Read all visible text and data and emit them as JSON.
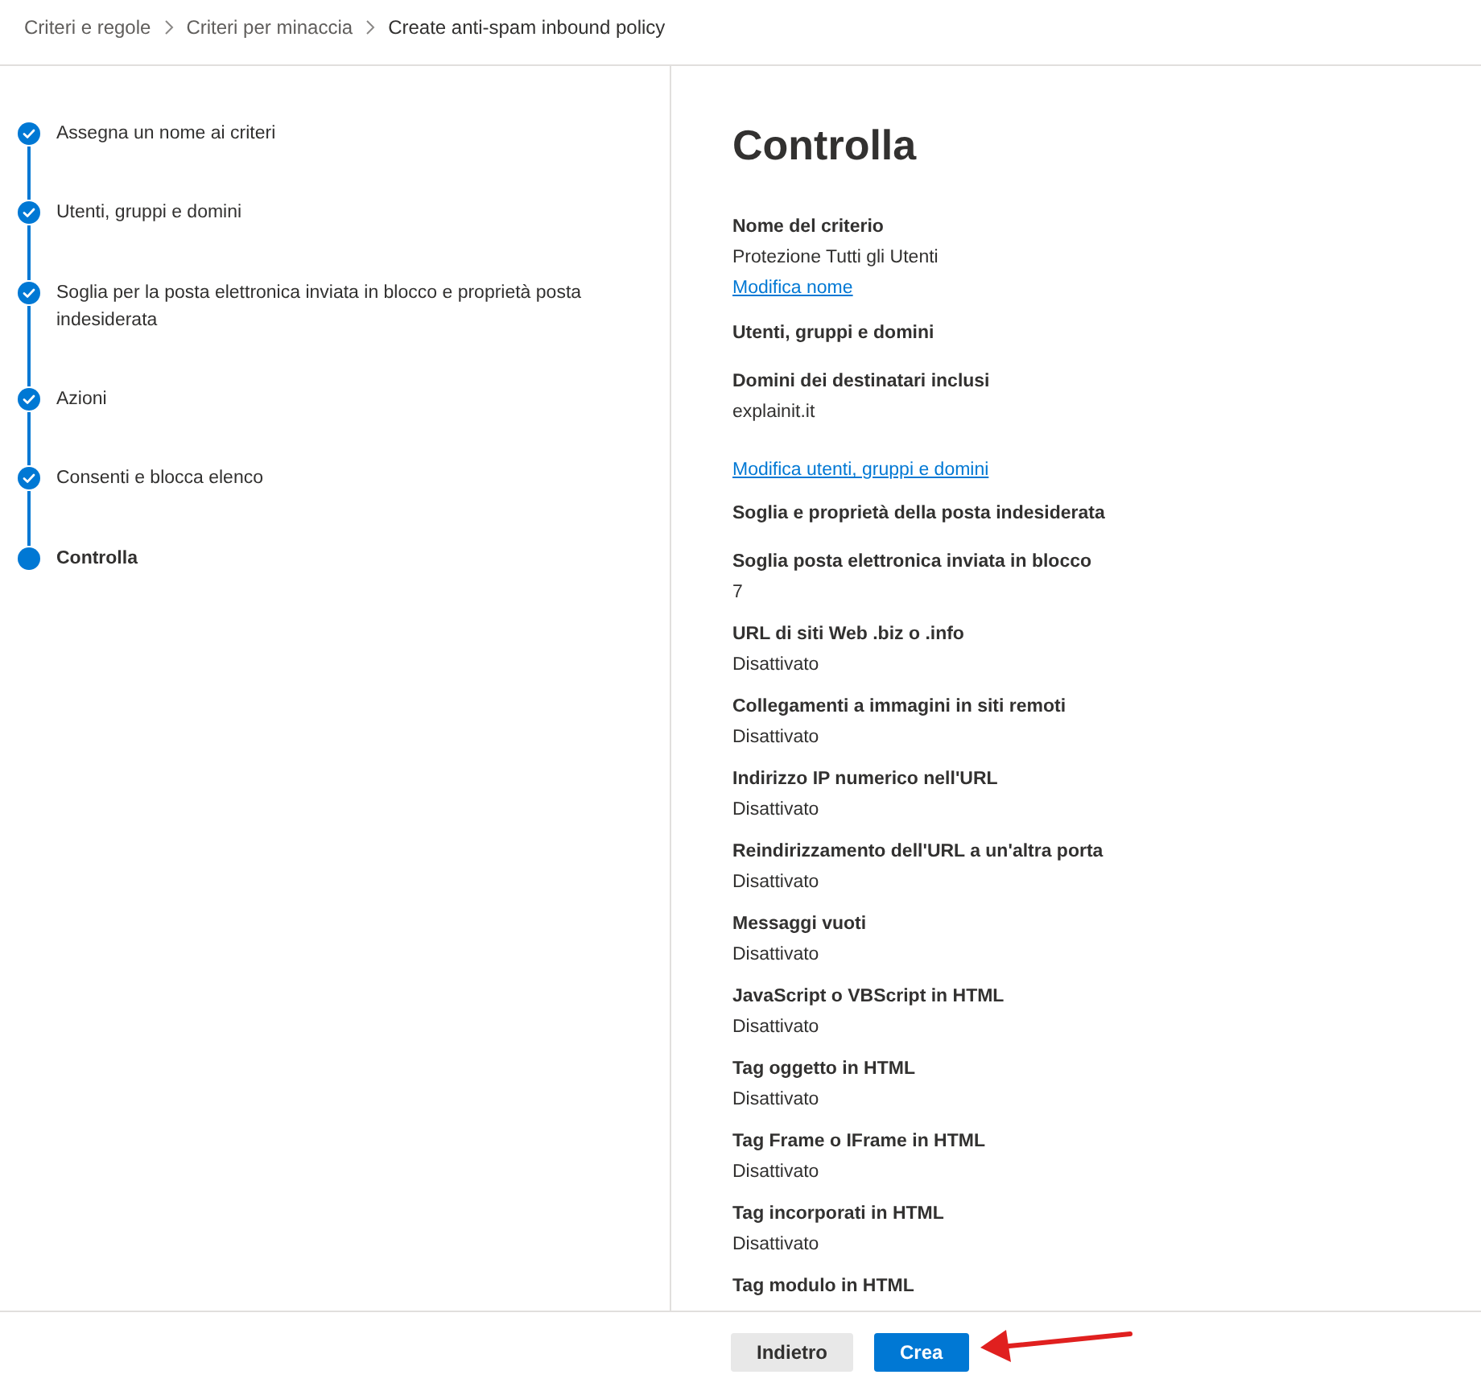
{
  "breadcrumb": [
    {
      "label": "Criteri e regole",
      "selected": false
    },
    {
      "label": "Criteri per minaccia",
      "selected": false
    },
    {
      "label": "Create anti-spam inbound policy",
      "selected": true
    }
  ],
  "steps": [
    {
      "label": "Assegna un nome ai criteri",
      "completed": true,
      "selected": false
    },
    {
      "label": "Utenti, gruppi e domini",
      "completed": true,
      "selected": false
    },
    {
      "label": "Soglia per la posta elettronica inviata in blocco e proprietà posta indesiderata",
      "completed": true,
      "selected": false
    },
    {
      "label": "Azioni",
      "completed": true,
      "selected": false
    },
    {
      "label": "Consenti e blocca elenco",
      "completed": true,
      "selected": false
    },
    {
      "label": "Controlla",
      "completed": false,
      "selected": true
    }
  ],
  "review": {
    "title": "Controlla",
    "items": [
      {
        "kind": "field",
        "label": "Nome del criterio",
        "value": "Protezione Tutti gli Utenti",
        "link": "Modifica nome"
      },
      {
        "kind": "heading",
        "text": "Utenti, gruppi e domini"
      },
      {
        "kind": "field",
        "label": "Domini dei destinatari inclusi",
        "value": "explainit.it"
      },
      {
        "kind": "link",
        "text": "Modifica utenti, gruppi e domini"
      },
      {
        "kind": "heading",
        "text": "Soglia e proprietà della posta indesiderata"
      },
      {
        "kind": "field",
        "label": "Soglia posta elettronica inviata in blocco",
        "value": "7"
      },
      {
        "kind": "field",
        "label": "URL di siti Web .biz o .info",
        "value": "Disattivato"
      },
      {
        "kind": "field",
        "label": "Collegamenti a immagini in siti remoti",
        "value": "Disattivato"
      },
      {
        "kind": "field",
        "label": "Indirizzo IP numerico nell'URL",
        "value": "Disattivato"
      },
      {
        "kind": "field",
        "label": "Reindirizzamento dell'URL a un'altra porta",
        "value": "Disattivato"
      },
      {
        "kind": "field",
        "label": "Messaggi vuoti",
        "value": "Disattivato"
      },
      {
        "kind": "field",
        "label": "JavaScript o VBScript in HTML",
        "value": "Disattivato"
      },
      {
        "kind": "field",
        "label": "Tag oggetto in HTML",
        "value": "Disattivato"
      },
      {
        "kind": "field",
        "label": "Tag Frame o IFrame in HTML",
        "value": "Disattivato"
      },
      {
        "kind": "field",
        "label": "Tag incorporati in HTML",
        "value": "Disattivato"
      },
      {
        "kind": "field",
        "label": "Tag modulo in HTML"
      }
    ]
  },
  "footer": {
    "buttons": [
      {
        "label": "Indietro",
        "kind": "secondary"
      },
      {
        "label": "Crea",
        "kind": "primary"
      }
    ]
  },
  "annotations": [
    {
      "kind": "arrow"
    }
  ]
}
